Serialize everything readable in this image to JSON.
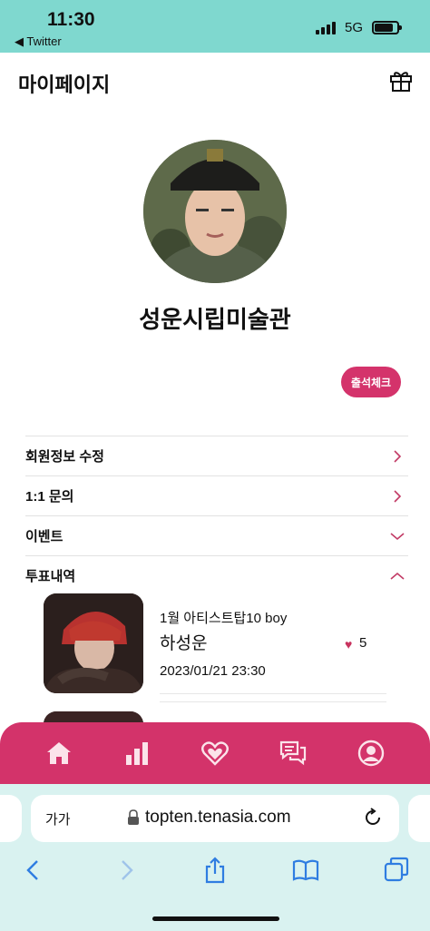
{
  "status_bar": {
    "time": "11:30",
    "back_app": "◀ Twitter",
    "network": "5G"
  },
  "header": {
    "title": "마이페이지",
    "gift_icon": "gift-icon"
  },
  "profile": {
    "name": "성운시립미술관",
    "attendance_label": "출석체크"
  },
  "menu": {
    "items": [
      {
        "label": "회원정보 수정",
        "icon": "chevron-right-icon"
      },
      {
        "label": "1:1 문의",
        "icon": "chevron-right-icon"
      },
      {
        "label": "이벤트",
        "icon": "chevron-down-icon"
      },
      {
        "label": "투표내역",
        "icon": "chevron-up-icon"
      }
    ]
  },
  "vote_history": [
    {
      "title": "1월 아티스트탑10 boy",
      "artist": "하성운",
      "votes": "5",
      "date": "2023/01/21 23:30"
    }
  ],
  "tab_bar": {
    "icons": [
      "home-icon",
      "chart-icon",
      "heart-icon",
      "chat-icon",
      "profile-icon"
    ]
  },
  "browser": {
    "aa_label": "가가",
    "url": "topten.tenasia.com",
    "toolbar_icons": [
      "back-icon",
      "forward-icon",
      "share-icon",
      "bookmarks-icon",
      "tabs-icon"
    ]
  },
  "colors": {
    "accent": "#d3336a",
    "status_bar_bg": "#7fd8cf",
    "browser_bg": "#d9f2f0"
  }
}
